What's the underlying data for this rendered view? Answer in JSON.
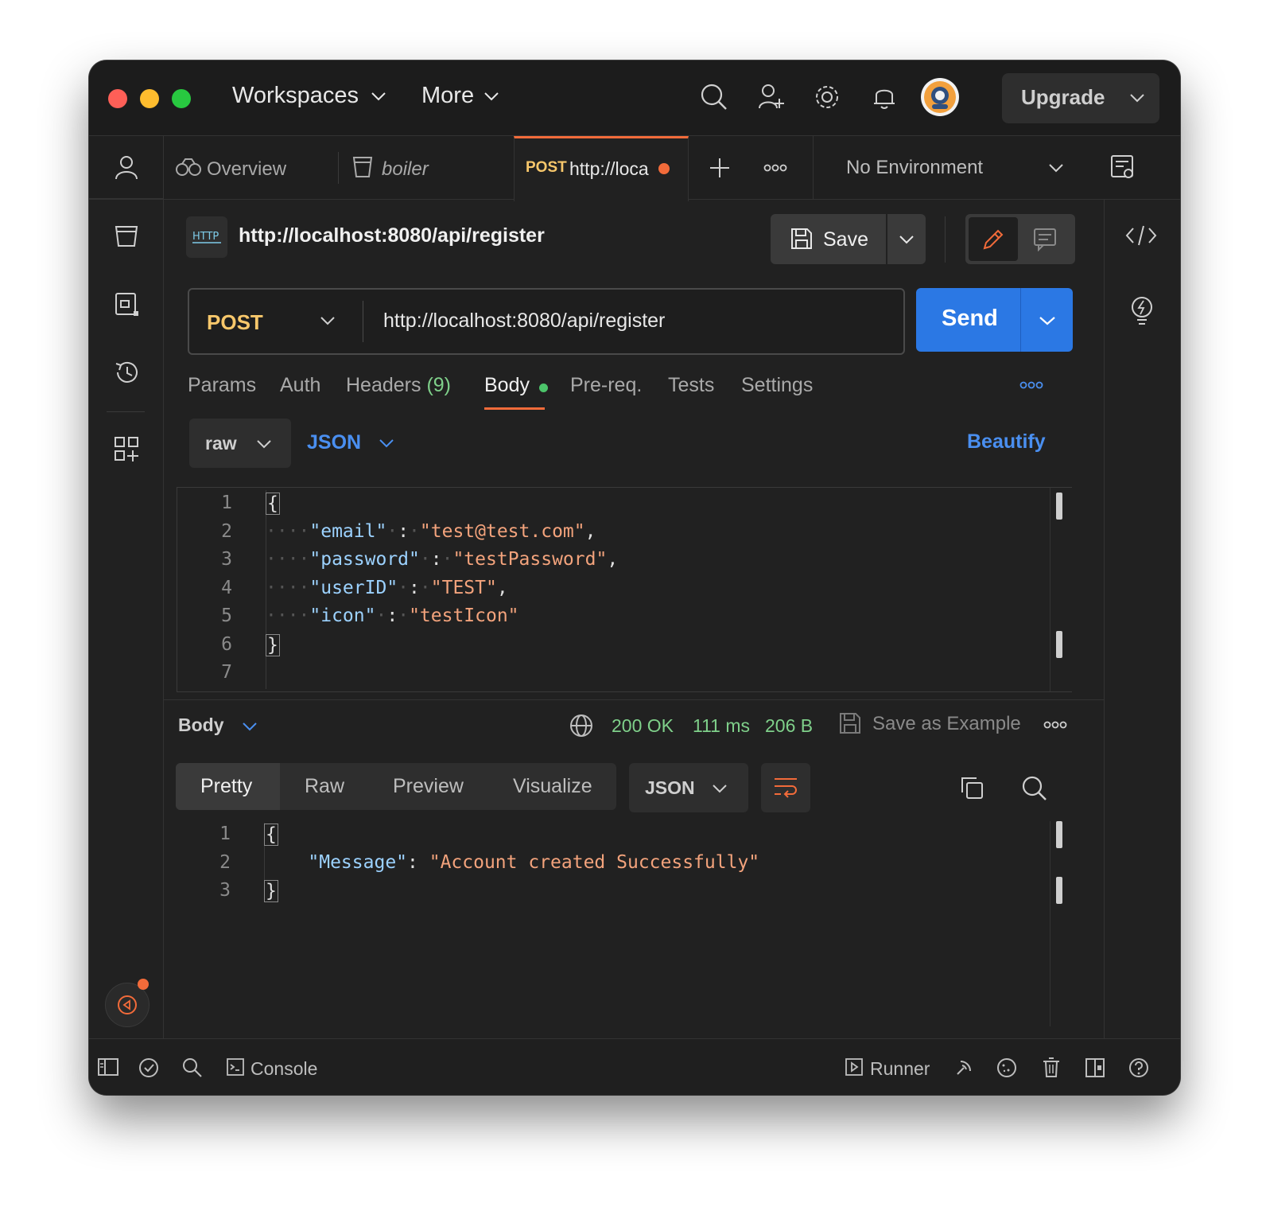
{
  "titlebar": {
    "workspaces_label": "Workspaces",
    "more_label": "More",
    "upgrade_label": "Upgrade"
  },
  "tabs": {
    "overview_label": "Overview",
    "boiler_label": "boiler",
    "active_method": "POST",
    "active_url": "http://loca",
    "environment": "No Environment"
  },
  "request": {
    "title": "http://localhost:8080/api/register",
    "save_label": "Save",
    "method": "POST",
    "url": "http://localhost:8080/api/register",
    "send_label": "Send",
    "tabs": {
      "params": "Params",
      "auth": "Auth",
      "headers": "Headers",
      "headers_count": "(9)",
      "body": "Body",
      "prereq": "Pre-req.",
      "tests": "Tests",
      "settings": "Settings"
    },
    "body_mode": "raw",
    "body_language": "JSON",
    "beautify_label": "Beautify",
    "body_lines": {
      "l1": "{",
      "l2_key": "\"email\"",
      "l2_val": "\"test@test.com\"",
      "l3_key": "\"password\"",
      "l3_val": "\"testPassword\"",
      "l4_key": "\"userID\"",
      "l4_val": "\"TEST\"",
      "l5_key": "\"icon\"",
      "l5_val": "\"testIcon\"",
      "l6": "}"
    },
    "line_numbers": [
      "1",
      "2",
      "3",
      "4",
      "5",
      "6",
      "7"
    ]
  },
  "response": {
    "body_label": "Body",
    "status": "200 OK",
    "time": "111 ms",
    "size": "206 B",
    "save_example_label": "Save as Example",
    "views": {
      "pretty": "Pretty",
      "raw": "Raw",
      "preview": "Preview",
      "visualize": "Visualize"
    },
    "format": "JSON",
    "lines": {
      "l1": "{",
      "l2_key": "\"Message\"",
      "l2_val": "\"Account created Successfully\"",
      "l3": "}"
    },
    "line_numbers": [
      "1",
      "2",
      "3"
    ]
  },
  "statusbar": {
    "console_label": "Console",
    "runner_label": "Runner"
  },
  "colors": {
    "accent_blue": "#2b78e4",
    "post_method": "#f7c76b",
    "active_tab_indicator": "#f26b3a",
    "status_green": "#7fd08a",
    "json_key": "#9cd2ff",
    "json_string": "#f3a37c"
  }
}
